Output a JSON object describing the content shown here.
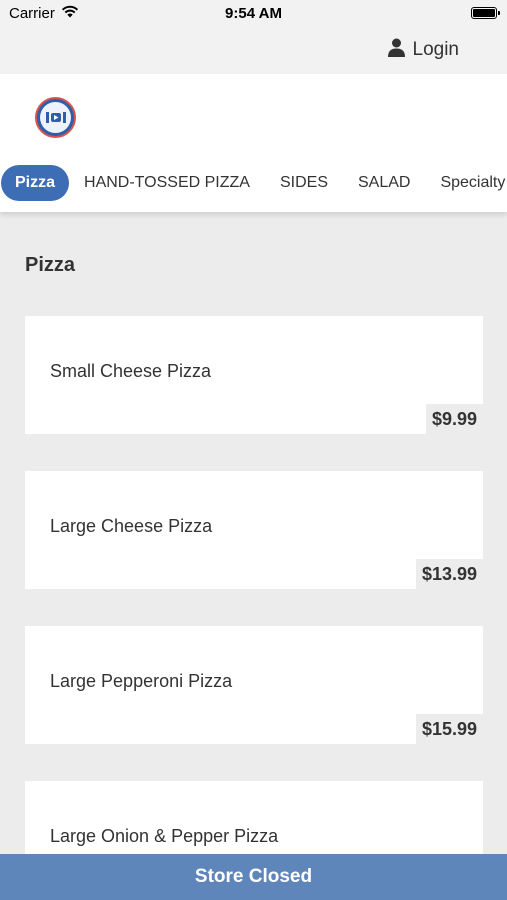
{
  "status_bar": {
    "carrier": "Carrier",
    "time": "9:54 AM"
  },
  "login": {
    "label": "Login",
    "icon": "person-icon"
  },
  "header": {
    "logo": "restaurant-logo"
  },
  "tabs": [
    {
      "label": "Pizza",
      "active": true
    },
    {
      "label": "HAND-TOSSED PIZZA",
      "active": false
    },
    {
      "label": "SIDES",
      "active": false
    },
    {
      "label": "SALAD",
      "active": false
    },
    {
      "label": "Specialty",
      "active": false
    }
  ],
  "section": {
    "title": "Pizza"
  },
  "items": [
    {
      "name": "Small Cheese Pizza",
      "price": "$9.99"
    },
    {
      "name": "Large Cheese Pizza",
      "price": "$13.99"
    },
    {
      "name": "Large Pepperoni Pizza",
      "price": "$15.99"
    },
    {
      "name": "Large Onion & Pepper Pizza",
      "price": ""
    }
  ],
  "footer": {
    "label": "Store Closed"
  },
  "colors": {
    "accent": "#3d6db5",
    "footer": "#5f86bb",
    "background": "#ececec"
  }
}
